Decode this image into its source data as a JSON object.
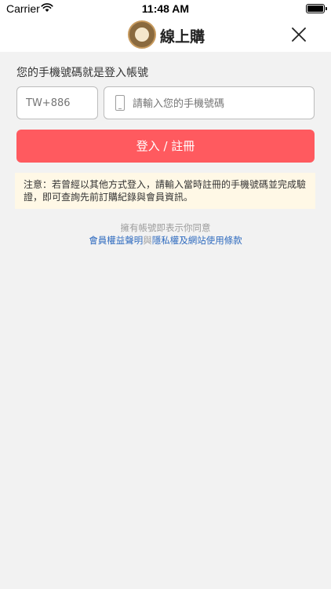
{
  "status_bar": {
    "carrier": "Carrier",
    "time": "11:48 AM"
  },
  "nav": {
    "title": "線上購",
    "logo_icon": "brand-logo-icon",
    "close_icon": "close-icon"
  },
  "form": {
    "phone_section_label": "您的手機號碼就是登入帳號",
    "country_code_placeholder": "TW+886",
    "phone_placeholder": "請輸入您的手機號碼",
    "submit_label": "登入 / 註冊"
  },
  "notice": {
    "text": "注意：若曾經以其他方式登入，請輸入當時註冊的手機號碼並完成驗證，即可查詢先前訂購紀錄與會員資訊。"
  },
  "agreement": {
    "prefix": "擁有帳號即表示你同意",
    "terms_link": "會員權益聲明",
    "and": "與",
    "privacy_link": "隱私權及網站使用條款"
  },
  "colors": {
    "accent": "#ff5a5f",
    "link": "#2f6bbf",
    "notice_bg": "#fff8e6",
    "page_bg": "#f2f2f2"
  }
}
